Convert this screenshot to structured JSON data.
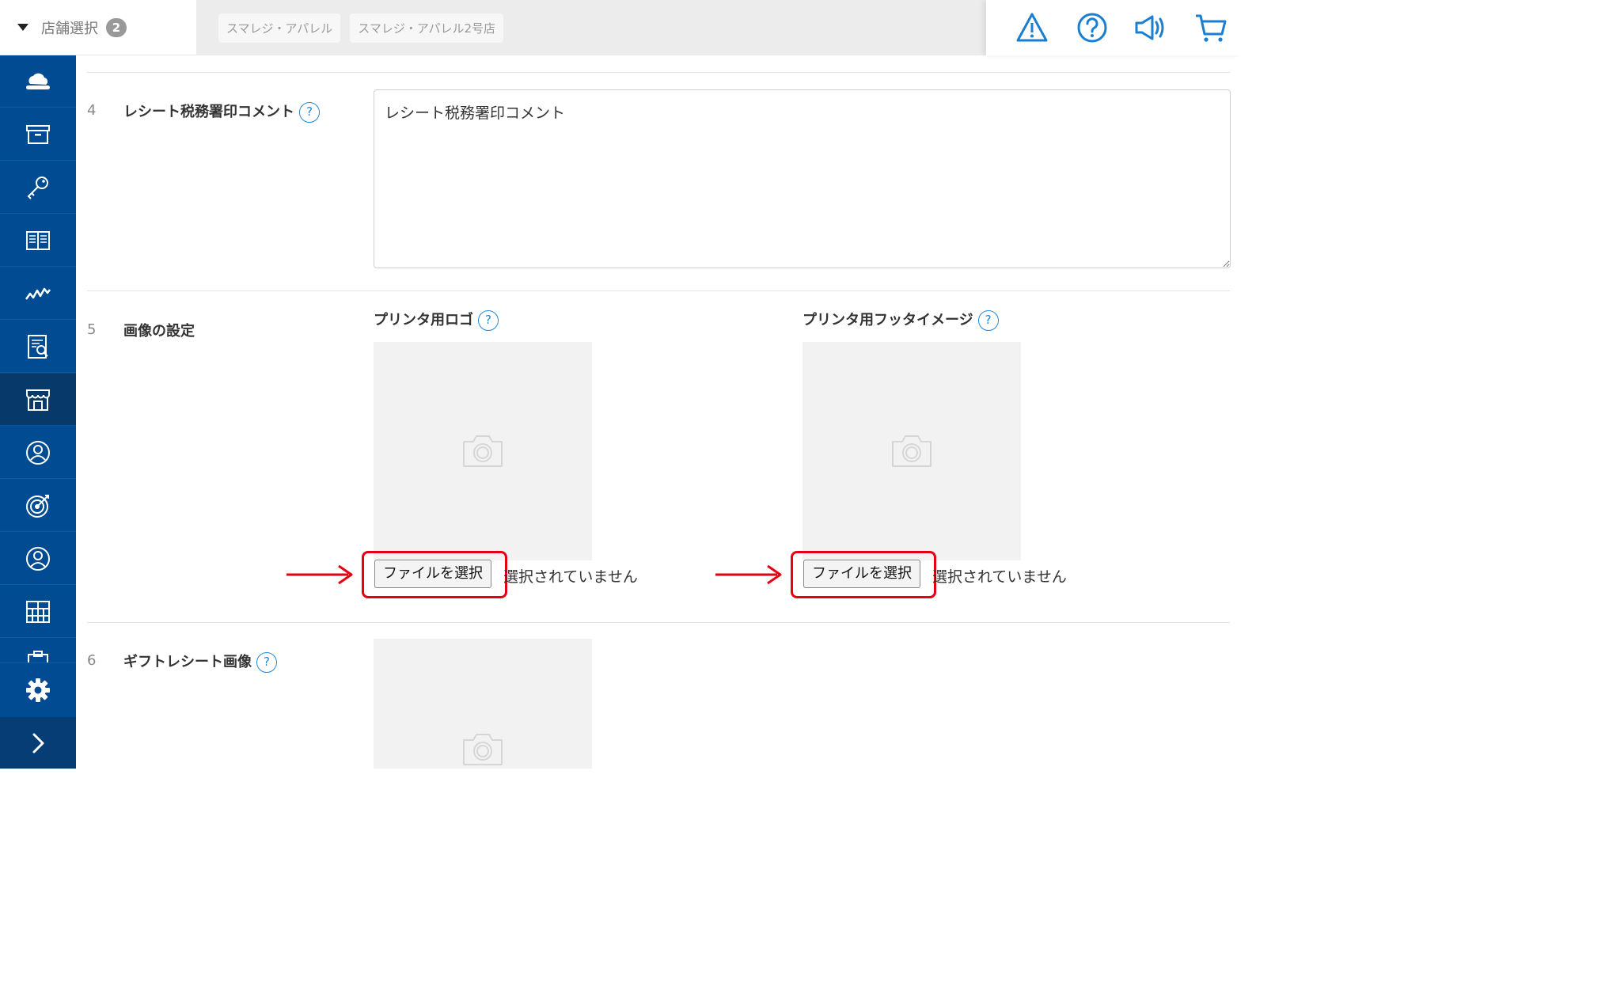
{
  "header": {
    "store_select_label": "店舗選択",
    "store_count": "2",
    "selected_stores": [
      "スマレジ・アパレル",
      "スマレジ・アパレル2号店"
    ],
    "icons": [
      "warning-icon",
      "help-icon",
      "announcement-icon",
      "cart-icon"
    ]
  },
  "sidebar": {
    "items": [
      "cloud-icon",
      "archive-icon",
      "key-icon",
      "book-icon",
      "chart-icon",
      "report-icon",
      "store-icon",
      "user-profile-icon",
      "target-icon",
      "member-icon",
      "grid-icon"
    ],
    "active_item": "store-icon",
    "bottom": [
      "gear-icon",
      "chevron-right-icon"
    ]
  },
  "rows": {
    "row4": {
      "num": "4",
      "label": "レシート税務署印コメント",
      "help": "?",
      "value": "レシート税務署印コメント"
    },
    "row5": {
      "num": "5",
      "label": "画像の設定",
      "logo": {
        "title": "プリンタ用ロゴ",
        "help": "?",
        "button": "ファイルを選択",
        "status": "選択されていません"
      },
      "footer": {
        "title": "プリンタ用フッタイメージ",
        "help": "?",
        "button": "ファイルを選択",
        "status": "選択されていません"
      }
    },
    "row6": {
      "num": "6",
      "label": "ギフトレシート画像",
      "help": "?"
    }
  },
  "colors": {
    "sidebar": "#004b91",
    "sidebar_active": "#07396b",
    "accent": "#1f8ad9",
    "highlight": "#e60012"
  }
}
